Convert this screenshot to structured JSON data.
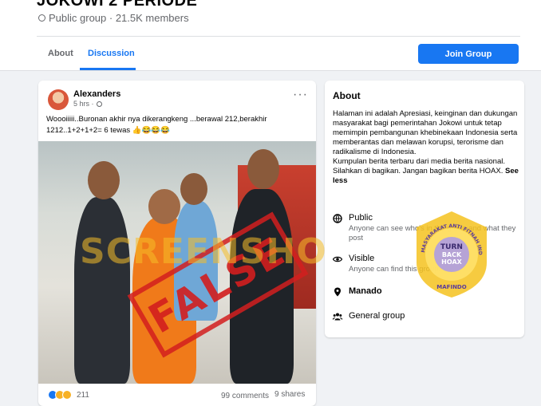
{
  "group": {
    "title": "JOKOWI 2 PERIODE",
    "meta": "Public group · 21.5K members"
  },
  "tabs": [
    {
      "label": "About"
    },
    {
      "label": "Discussion"
    }
  ],
  "join_button": "Join Group",
  "post": {
    "author": "Alexanders",
    "time": "5 hrs ·",
    "text": "Woooiiiii..Buronan akhir nya dikerangkeng ...berawal 212,berakhir 1212..1+2+1+2= 6 tewas 👍😂😂😂",
    "stamp": "FALSE",
    "watermark": "SCREENSHOT BY",
    "reaction_count": "211",
    "comments": "99 comments",
    "shares": "9 shares"
  },
  "about": {
    "title": "About",
    "description": "Halaman ini adalah Apresiasi, keinginan dan dukungan masyarakat bagi pemerintahan Jokowi untuk tetap memimpin pembangunan khebinekaan Indonesia serta memberantas dan melawan korupsi, terorisme dan radikalisme di Indonesia.",
    "description2": "Kumpulan berita terbaru dari media berita nasional. Silahkan di bagikan. Jangan bagikan berita HOAX.",
    "see_less": "See less",
    "public_label": "Public",
    "public_sub": "Anyone can see who's in the group and what they post",
    "visible_label": "Visible",
    "visible_sub": "Anyone can find this group.",
    "location": "Manado",
    "category": "General group"
  },
  "badge": {
    "ring_text": "MASYARAKAT ANTI FITNAH INDONESIA",
    "center_top": "TURN",
    "center_mid": "BACK",
    "center_bottom": "HOAX",
    "bottom": "MAFINDO"
  },
  "colors": {
    "accent": "#1877f2",
    "stamp_red": "#d21e1e",
    "watermark_yellow": "#f5be28"
  }
}
